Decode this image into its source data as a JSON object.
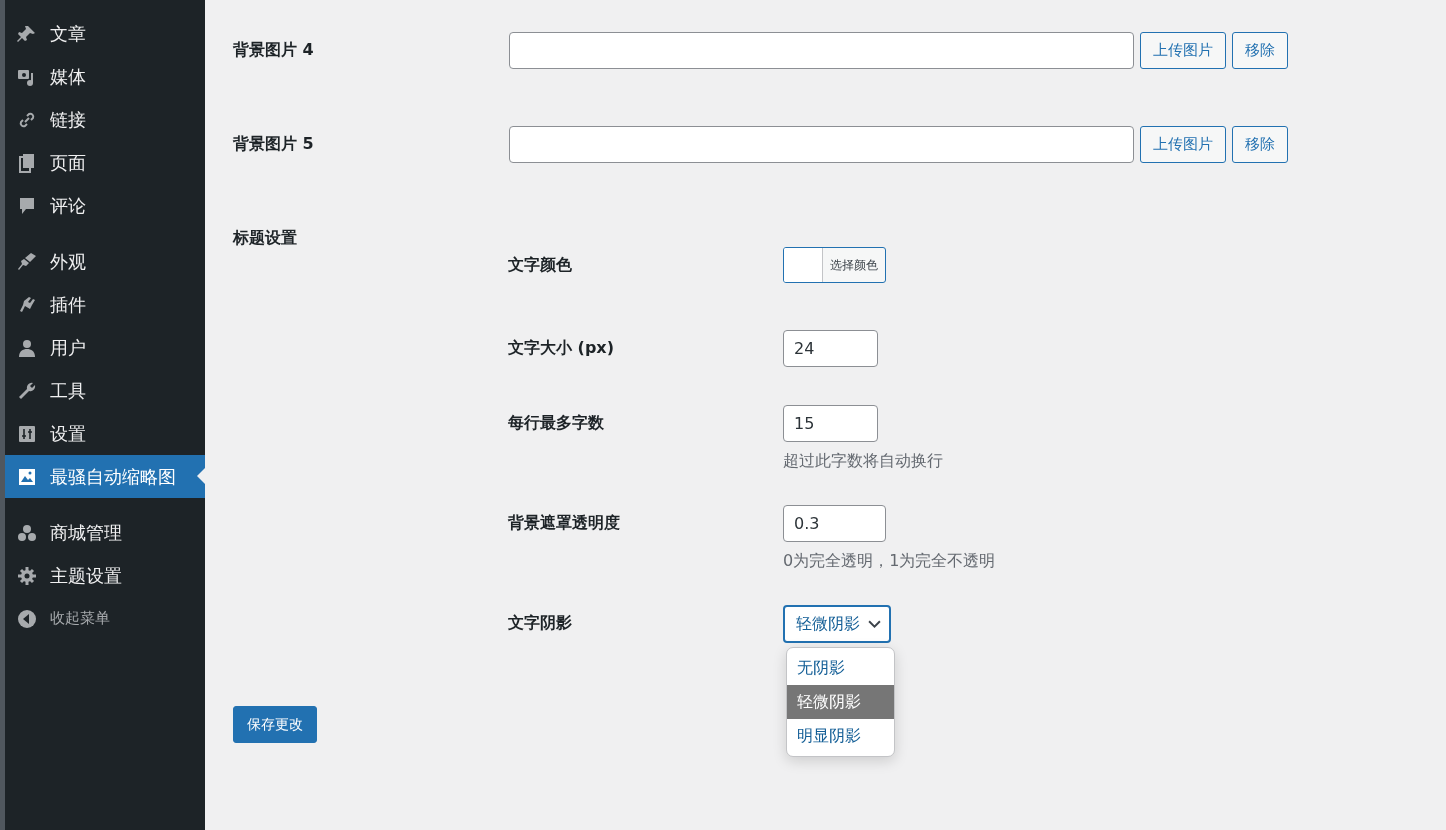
{
  "sidebar": {
    "groups": [
      [
        {
          "label": "文章",
          "selected": false
        },
        {
          "label": "媒体",
          "selected": false
        },
        {
          "label": "链接",
          "selected": false
        },
        {
          "label": "页面",
          "selected": false
        },
        {
          "label": "评论",
          "selected": false
        }
      ],
      [
        {
          "label": "外观",
          "selected": false
        },
        {
          "label": "插件",
          "selected": false
        },
        {
          "label": "用户",
          "selected": false
        },
        {
          "label": "工具",
          "selected": false
        },
        {
          "label": "设置",
          "selected": false
        },
        {
          "label": "最骚自动缩略图",
          "selected": true
        }
      ],
      [
        {
          "label": "商城管理",
          "selected": false
        },
        {
          "label": "主题设置",
          "selected": false
        }
      ]
    ],
    "collapse": {
      "label": "收起菜单"
    }
  },
  "background_images": [
    {
      "label": "背景图片 4",
      "upload": "上传图片",
      "remove": "移除"
    },
    {
      "label": "背景图片 5",
      "upload": "上传图片",
      "remove": "移除"
    }
  ],
  "title_settings": {
    "heading": "标题设置",
    "fields": [
      {
        "kind": "color",
        "label": "文字颜色",
        "button": "选择颜色"
      },
      {
        "kind": "text",
        "label": "文字大小 (px)",
        "value": "24"
      },
      {
        "kind": "text",
        "label": "每行最多字数",
        "value": "15",
        "hint": "超过此字数将自动换行"
      },
      {
        "kind": "text",
        "label": "背景遮罩透明度",
        "value": "0.3",
        "hint": "0为完全透明，1为完全不透明"
      },
      {
        "kind": "select",
        "label": "文字阴影",
        "value": "轻微阴影",
        "expanded": true,
        "options": [
          {
            "label": "无阴影",
            "selected": false
          },
          {
            "label": "轻微阴影",
            "selected": true
          },
          {
            "label": "明显阴影",
            "selected": false
          }
        ]
      }
    ]
  },
  "save_button": "保存更改"
}
